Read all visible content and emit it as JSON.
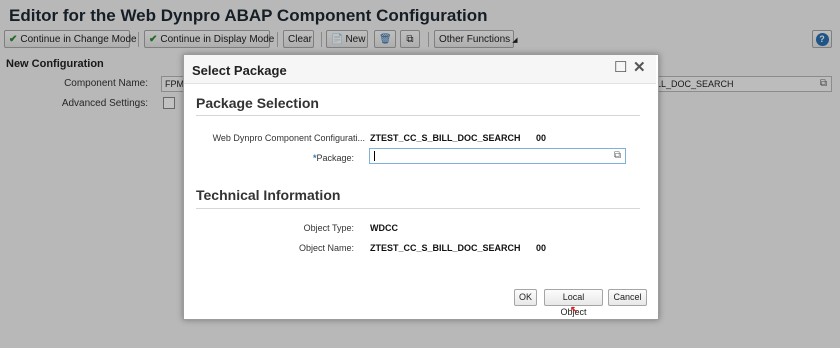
{
  "app": {
    "title": "Editor for the Web Dynpro ABAP Component Configuration"
  },
  "toolbar": {
    "continue_change": "Continue in Change Mode",
    "continue_display": "Continue in Display Mode",
    "clear": "Clear",
    "new": "New",
    "other_functions": "Other Functions",
    "help": "?"
  },
  "form": {
    "section": "New Configuration",
    "component_name_label": "Component Name:",
    "component_name_value": "FPM",
    "advanced_settings_label": "Advanced Settings:",
    "config_id_value": "LL_DOC_SEARCH"
  },
  "dialog": {
    "title": "Select Package",
    "package_selection": {
      "title": "Package Selection",
      "config_label": "Web Dynpro Component Configurati...",
      "config_name": "ZTEST_CC_S_BILL_DOC_SEARCH",
      "config_number": "00",
      "package_required": "*",
      "package_label": "Package:",
      "package_value": ""
    },
    "technical_information": {
      "title": "Technical Information",
      "object_type_label": "Object Type:",
      "object_type_value": "WDCC",
      "object_name_label": "Object Name:",
      "object_name_value": "ZTEST_CC_S_BILL_DOC_SEARCH",
      "object_name_number": "00"
    },
    "buttons": {
      "ok": "OK",
      "local_object": "Local Object",
      "cancel": "Cancel"
    }
  },
  "colors": {
    "accent": "#2a7bc0",
    "annotation_arrow": "#d32020",
    "check": "#2e8b2e"
  },
  "icons": [
    "checkmark-icon",
    "new-document-icon",
    "trash-icon",
    "copy-icon",
    "help-icon",
    "maximize-icon",
    "close-icon",
    "value-help-icon",
    "arrow-annotation-icon"
  ]
}
